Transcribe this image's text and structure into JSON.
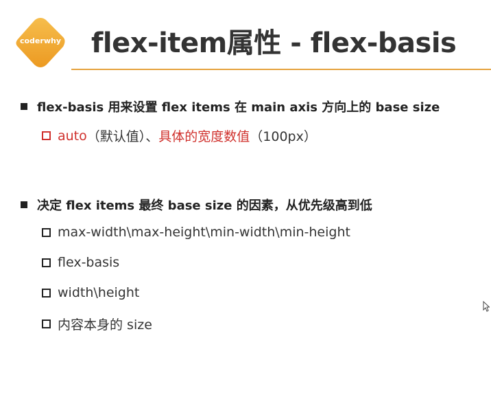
{
  "logo": {
    "text": "coderwhy",
    "color": "#f0a830"
  },
  "slide": {
    "title": "flex-item属性 - flex-basis",
    "accent_color": "#e6a23c",
    "section1": {
      "bullet": "flex-basis 用来设置 flex items 在 main axis 方向上的 base size",
      "sub": {
        "part1": "auto",
        "part2": "（默认值）、",
        "part3": "具体的宽度数值",
        "part4": "（100px）"
      }
    },
    "section2": {
      "bullet": "决定 flex items 最终 base size 的因素，从优先级高到低",
      "items": [
        "max-width\\max-height\\min-width\\min-height",
        "flex-basis",
        "width\\height",
        "内容本身的 size"
      ]
    }
  },
  "colors": {
    "red": "#d0312d",
    "text": "#333333"
  }
}
